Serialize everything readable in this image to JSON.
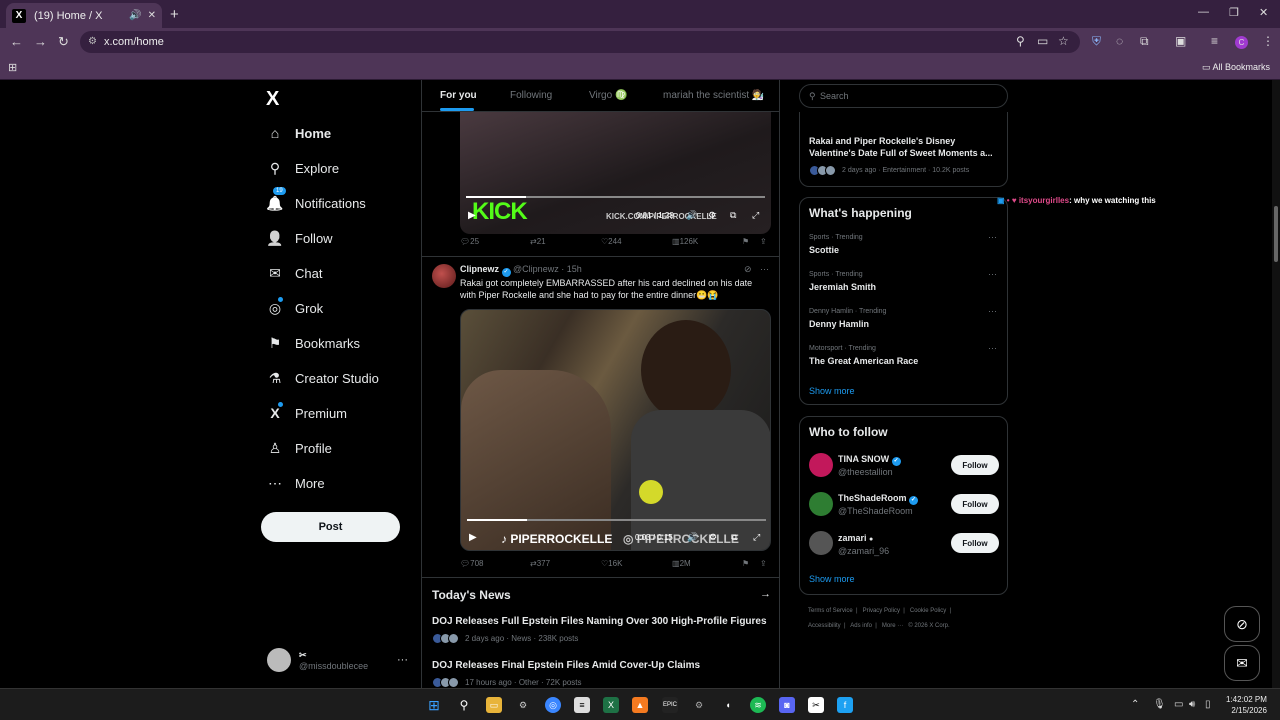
{
  "browser": {
    "tab_title": "(19) Home / X",
    "tab_favicon": "X",
    "new_tab": "+",
    "url": "x.com/home",
    "all_bookmarks": "All Bookmarks",
    "win_min": "—",
    "win_max": "❐",
    "win_close": "✕"
  },
  "nav": {
    "logo": "X",
    "items": [
      {
        "label": "Home",
        "icon": "⌂"
      },
      {
        "label": "Explore",
        "icon": "⚲"
      },
      {
        "label": "Notifications",
        "icon": "🔔",
        "badge": "19"
      },
      {
        "label": "Follow",
        "icon": "👤"
      },
      {
        "label": "Chat",
        "icon": "✉"
      },
      {
        "label": "Grok",
        "icon": "◎"
      },
      {
        "label": "Bookmarks",
        "icon": "⚑"
      },
      {
        "label": "Creator Studio",
        "icon": "⚗"
      },
      {
        "label": "Premium",
        "icon": "X"
      },
      {
        "label": "Profile",
        "icon": "♙"
      },
      {
        "label": "More",
        "icon": "⋯"
      }
    ],
    "post_label": "Post",
    "account_name": "✂",
    "account_handle": "@missdoublecee",
    "account_more": "···"
  },
  "feed": {
    "tabs": [
      "For you",
      "Following",
      "Virgo ♍",
      "mariah the scientist 🧑‍🔬"
    ],
    "tweet1": {
      "watermark_logo": "KICK",
      "watermark_text": "KICK.COM/PIPERROCKELLE",
      "video_time": "0:01 / 1:29",
      "video_progress": 0.2,
      "replies": "25",
      "reposts": "21",
      "likes": "244",
      "views": "126K"
    },
    "tweet2": {
      "name": "Clipnewz",
      "handle": "@Clipnewz",
      "time": "15h",
      "text": "Rakai got completely EMBARRASSED after his card declined on his date with Piper Rockelle and she had to pay for the entire dinner😬😭",
      "watermark1": "♪ PIPERROCKELLE",
      "watermark2": "◎ PIPERROCKELLE",
      "video_time": "0:03 / 0:15",
      "video_progress": 0.2,
      "replies": "708",
      "reposts": "377",
      "likes": "16K",
      "views": "2M"
    },
    "news_title": "Today's News",
    "news": [
      {
        "headline": "DOJ Releases Full Epstein Files Naming Over 300 High-Profile Figures",
        "meta": "2 days ago · News · 238K posts"
      },
      {
        "headline": "DOJ Releases Final Epstein Files Amid Cover-Up Claims",
        "meta": "17 hours ago · Other · 72K posts"
      }
    ]
  },
  "sidebar": {
    "search_placeholder": "Search",
    "top_story": {
      "headline": "Rakai and Piper Rockelle's Disney Valentine's Date Full of Sweet Moments a...",
      "meta": "2 days ago · Entertainment · 10.2K posts"
    },
    "happening_title": "What's happening",
    "trends": [
      {
        "context": "Sports · Trending",
        "name": "Scottie"
      },
      {
        "context": "Sports · Trending",
        "name": "Jeremiah Smith"
      },
      {
        "context": "Denny Hamlin · Trending",
        "name": "Denny Hamlin"
      },
      {
        "context": "Motorsport · Trending",
        "name": "The Great American Race"
      }
    ],
    "show_more": "Show more",
    "wtf_title": "Who to follow",
    "wtf": [
      {
        "name": "TINA SNOW",
        "handle": "@theestallion",
        "verified": true,
        "color": "#c2185b"
      },
      {
        "name": "TheShadeRoom",
        "handle": "@TheShadeRoom",
        "verified": true,
        "color": "#2e7d32"
      },
      {
        "name": "zamari",
        "handle": "@zamari_96",
        "verified": false,
        "color": "#555555"
      }
    ],
    "follow_label": "Follow",
    "footer1": [
      "Terms of Service",
      "|",
      "Privacy Policy",
      "|",
      "Cookie Policy",
      "|"
    ],
    "footer2": [
      "Accessibility",
      "|",
      "Ads info",
      "|",
      "More ···",
      "© 2026 X Corp."
    ]
  },
  "overlay": {
    "user": "itsyourgirlles",
    "message": ": why we watching this"
  },
  "taskbar": {
    "time": "1:42:02 PM",
    "date": "2/15/2026"
  }
}
